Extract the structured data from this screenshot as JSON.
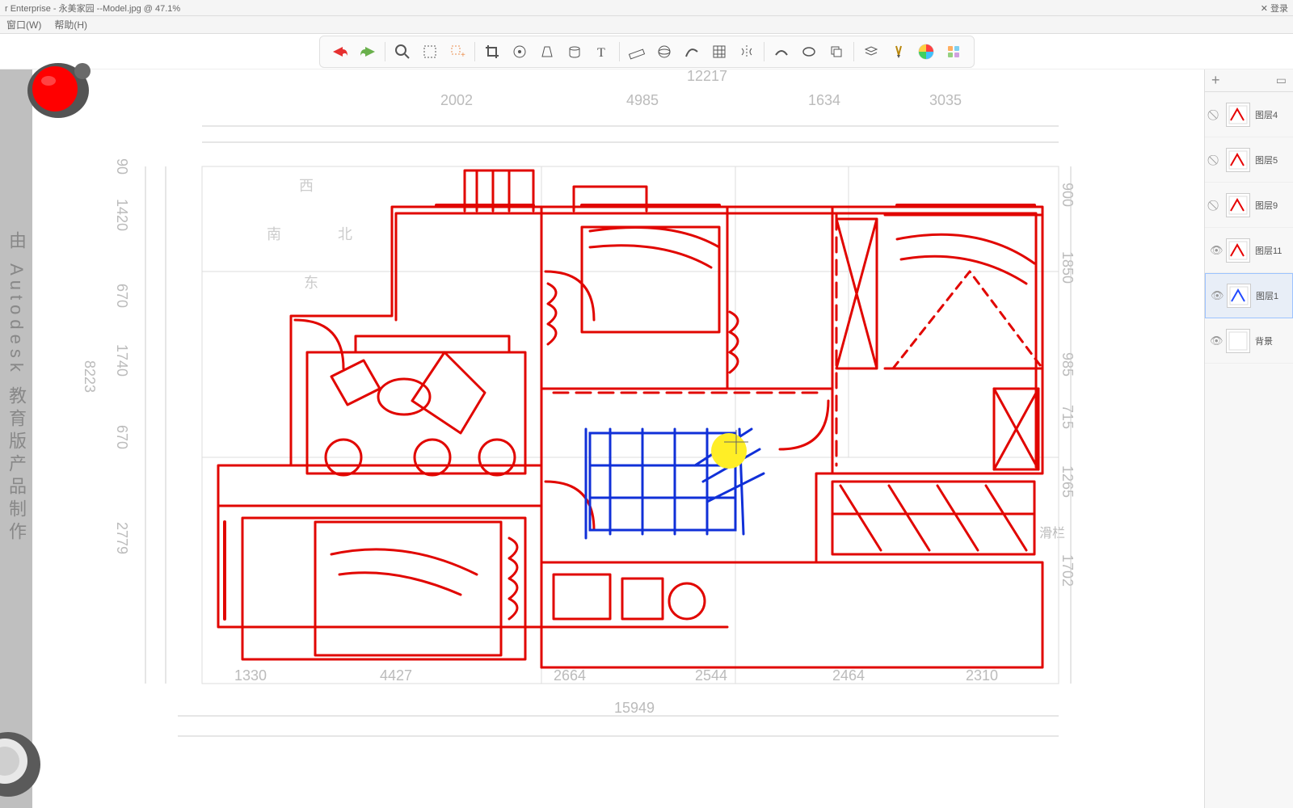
{
  "app": {
    "title_fragment": "r Enterprise - 永美家园 --Model.jpg @ 47.1%",
    "login_label": "✕ 登录"
  },
  "menu": {
    "window": "窗口(W)",
    "help": "帮助(H)"
  },
  "toolbar": {
    "undo": "↶",
    "redo": "↷"
  },
  "watermark": "由 Autodesk 教育版产品制作",
  "compass": {
    "n": "北",
    "s": "南",
    "e": "东",
    "w": "西"
  },
  "dimensions": {
    "top_total": "12217",
    "top_segs": [
      "2002",
      "4985",
      "1634",
      "3035"
    ],
    "bottom_total": "15949",
    "bottom_segs": [
      "1330",
      "4427",
      "2664",
      "2544",
      "2464",
      "2310"
    ],
    "left_total": "8223",
    "left_segs": [
      "90",
      "1420",
      "670",
      "1740",
      "670",
      "2779"
    ],
    "right_total": "",
    "right_segs": [
      "900",
      "1850",
      "985",
      "715",
      "1265",
      "1702"
    ]
  },
  "layers": {
    "add": "+",
    "folder": "🗂",
    "toolbar_label": "滑栏",
    "items": [
      {
        "name": "图层4",
        "visible": false,
        "thumb_color": "#e60000"
      },
      {
        "name": "图层5",
        "visible": false,
        "thumb_color": "#e60000"
      },
      {
        "name": "图层9",
        "visible": false,
        "thumb_color": "#e60000"
      },
      {
        "name": "图层11",
        "visible": true,
        "thumb_color": "#e60000"
      },
      {
        "name": "图层1",
        "visible": true,
        "thumb_color": "#224aff",
        "selected": true
      },
      {
        "name": "背景",
        "visible": true,
        "thumb_color": "#ffffff"
      }
    ]
  }
}
